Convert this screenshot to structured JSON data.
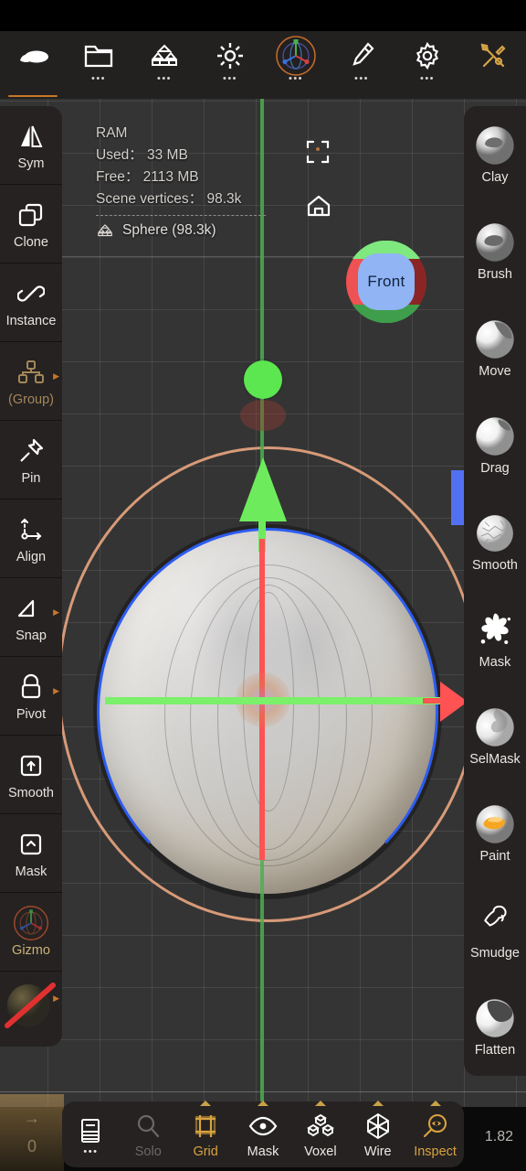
{
  "app": {
    "version_label": "1.82"
  },
  "topbar": {
    "items": [
      {
        "name": "sculpt-tool",
        "icon": "stone-sculpt-icon",
        "dots": "",
        "active": true
      },
      {
        "name": "files",
        "icon": "folder-icon",
        "dots": "•••",
        "active": false
      },
      {
        "name": "layers",
        "icon": "stack-cubes-icon",
        "dots": "•••",
        "active": false
      },
      {
        "name": "lighting",
        "icon": "sun-icon",
        "dots": "•••",
        "active": false
      },
      {
        "name": "scene-gizmo",
        "icon": "axis-gizmo-icon",
        "dots": "•••",
        "active": false
      },
      {
        "name": "paint",
        "icon": "brush-pen-icon",
        "dots": "•••",
        "active": false
      },
      {
        "name": "settings",
        "icon": "gear-icon",
        "dots": "•••",
        "active": false
      },
      {
        "name": "tools",
        "icon": "tools-wrench-icon",
        "dots": "",
        "active": false
      }
    ]
  },
  "viewport": {
    "info": {
      "ram_title": "RAM",
      "used": "Used： 33 MB",
      "free": "Free： 2113 MB",
      "scene_vertices": "Scene vertices： 98.3k",
      "object": "Sphere (98.3k)"
    },
    "navcube_label": "Front",
    "icons": {
      "frame": "frame-selection-icon",
      "home": "home-view-icon",
      "navcube": "view-orientation-cube"
    },
    "colors": {
      "axis_x": "#ff5252",
      "axis_y": "#6eeb5d",
      "axis_z": "#2d5cf0",
      "orbit_ring": "#d79a78",
      "slider": "#5271f2",
      "background": "#343434"
    }
  },
  "left_sidebar": {
    "items": [
      {
        "label": "Sym",
        "icon": "symmetry-mirror-icon",
        "arrow": false,
        "style": "normal"
      },
      {
        "label": "Clone",
        "icon": "clone-squares-icon",
        "arrow": false,
        "style": "normal"
      },
      {
        "label": "Instance",
        "icon": "link-chain-icon",
        "arrow": false,
        "style": "normal"
      },
      {
        "label": "(Group)",
        "icon": "group-hierarchy-icon",
        "arrow": true,
        "style": "dim"
      },
      {
        "label": "Pin",
        "icon": "pin-icon",
        "arrow": false,
        "style": "normal"
      },
      {
        "label": "Align",
        "icon": "align-arrow-icon",
        "arrow": false,
        "style": "normal"
      },
      {
        "label": "Snap",
        "icon": "snap-triangle-icon",
        "arrow": true,
        "style": "normal"
      },
      {
        "label": "Pivot",
        "icon": "lock-pivot-icon",
        "arrow": true,
        "style": "normal"
      },
      {
        "label": "Smooth",
        "icon": "smooth-up-box-icon",
        "arrow": false,
        "style": "normal"
      },
      {
        "label": "Mask",
        "icon": "mask-caret-box-icon",
        "arrow": false,
        "style": "normal"
      },
      {
        "label": "Gizmo",
        "icon": "gizmo-orbit-icon",
        "arrow": false,
        "style": "gizmo"
      }
    ],
    "material_preview": {
      "name": "material-sphere-disabled",
      "strikethrough_color": "#e03030"
    }
  },
  "right_sidebar": {
    "brushes": [
      {
        "label": "Clay",
        "icon": "clay-brush-ball"
      },
      {
        "label": "Brush",
        "icon": "brush-ball"
      },
      {
        "label": "Move",
        "icon": "move-brush-ball"
      },
      {
        "label": "Drag",
        "icon": "drag-brush-ball"
      },
      {
        "label": "Smooth",
        "icon": "smooth-brush-ball"
      },
      {
        "label": "Mask",
        "icon": "mask-splat-icon"
      },
      {
        "label": "SelMask",
        "icon": "selmask-brush-ball"
      },
      {
        "label": "Paint",
        "icon": "paint-brush-ball"
      },
      {
        "label": "Smudge",
        "icon": "smudge-finger-icon"
      },
      {
        "label": "Flatten",
        "icon": "flatten-brush-ball"
      }
    ],
    "active": "Mask"
  },
  "bottom_bar": {
    "items": [
      {
        "label": "•••",
        "icon": "book-menu-icon",
        "state": "normal",
        "caret": false
      },
      {
        "label": "Solo",
        "icon": "magnifier-icon",
        "state": "muted",
        "caret": false
      },
      {
        "label": "Grid",
        "icon": "grid-frame-icon",
        "state": "accent",
        "caret": true
      },
      {
        "label": "Mask",
        "icon": "eye-icon",
        "state": "normal",
        "caret": true
      },
      {
        "label": "Voxel",
        "icon": "voxel-cubes-icon",
        "state": "normal",
        "caret": true
      },
      {
        "label": "Wire",
        "icon": "wireframe-icon",
        "state": "normal",
        "caret": true
      },
      {
        "label": "Inspect",
        "icon": "inspect-eye-magnifier-icon",
        "state": "accent",
        "caret": true
      }
    ]
  },
  "ghost_left": {
    "arrow": "→",
    "value": "0"
  }
}
